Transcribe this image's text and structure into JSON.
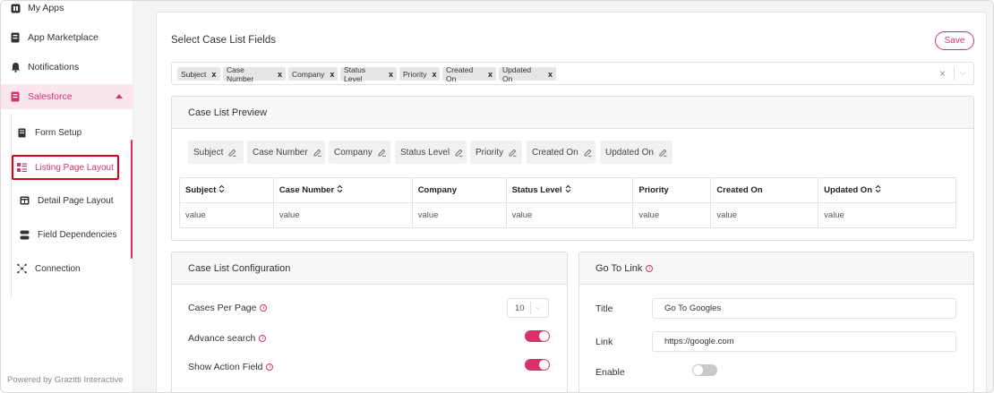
{
  "sidebar": {
    "items": [
      {
        "label": "My Apps",
        "icon": "apps-icon"
      },
      {
        "label": "App Marketplace",
        "icon": "marketplace-icon"
      },
      {
        "label": "Notifications",
        "icon": "bell-icon"
      },
      {
        "label": "Salesforce",
        "icon": "salesforce-icon",
        "active": true
      }
    ],
    "subitems": [
      {
        "label": "Form Setup",
        "icon": "form-icon"
      },
      {
        "label": "Listing Page Layout",
        "icon": "list-layout-icon",
        "selected": true
      },
      {
        "label": "Detail Page Layout",
        "icon": "detail-layout-icon"
      },
      {
        "label": "Field Dependencies",
        "icon": "dependencies-icon"
      },
      {
        "label": "Connection",
        "icon": "connection-icon"
      }
    ],
    "footer": "Powered by Grazitti Interactive"
  },
  "main": {
    "title": "Select Case List Fields",
    "save_label": "Save",
    "selected_fields": [
      "Subject",
      "Case Number",
      "Company",
      "Status Level",
      "Priority",
      "Created On",
      "Updated On"
    ],
    "clear_symbol": "×",
    "chevron_symbol": "⌵"
  },
  "preview": {
    "title": "Case List Preview",
    "chips": [
      "Subject",
      "Case Number",
      "Company",
      "Status Level",
      "Priority",
      "Created On",
      "Updated On"
    ],
    "columns": [
      {
        "label": "Subject",
        "sortable": true
      },
      {
        "label": "Case Number",
        "sortable": true
      },
      {
        "label": "Company",
        "sortable": false
      },
      {
        "label": "Status Level",
        "sortable": true
      },
      {
        "label": "Priority",
        "sortable": false
      },
      {
        "label": "Created On",
        "sortable": false
      },
      {
        "label": "Updated On",
        "sortable": true
      }
    ],
    "row": [
      "value",
      "value",
      "value",
      "value",
      "value",
      "value",
      "value"
    ]
  },
  "config": {
    "title": "Case List Configuration",
    "cases_per_page_label": "Cases Per Page",
    "cases_per_page_value": "10",
    "advance_search_label": "Advance search",
    "advance_search_on": true,
    "show_action_label": "Show Action Field",
    "show_action_on": true
  },
  "goto": {
    "title": "Go To Link",
    "title_label": "Title",
    "title_value": "Go To Googles",
    "link_label": "Link",
    "link_value": "https://google.com",
    "enable_label": "Enable",
    "enable_on": false
  },
  "colors": {
    "accent": "#d6336c",
    "highlight_border": "#e0001b"
  }
}
